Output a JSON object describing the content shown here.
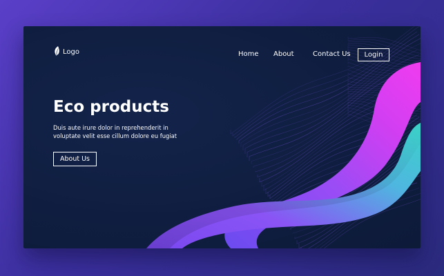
{
  "logo": {
    "label": "Logo",
    "icon": "leaf-icon"
  },
  "nav": {
    "home": "Home",
    "about": "About",
    "contact": "Contact Us",
    "login": "Login"
  },
  "hero": {
    "title": "Eco products",
    "body_line1": "Duis aute irure dolor in reprehenderit in",
    "body_line2": "voluptate velit esse cillum dolore eu fugiat",
    "button": "About Us"
  },
  "colors": {
    "outer_background": "#4b37b4",
    "page_background": "#0f1e40",
    "wave_magenta": "#e43cf0",
    "wave_purple": "#9b4cf5",
    "wave_teal": "#3ad3c8",
    "line_color": "#8b5cf6",
    "text": "#ffffff"
  }
}
